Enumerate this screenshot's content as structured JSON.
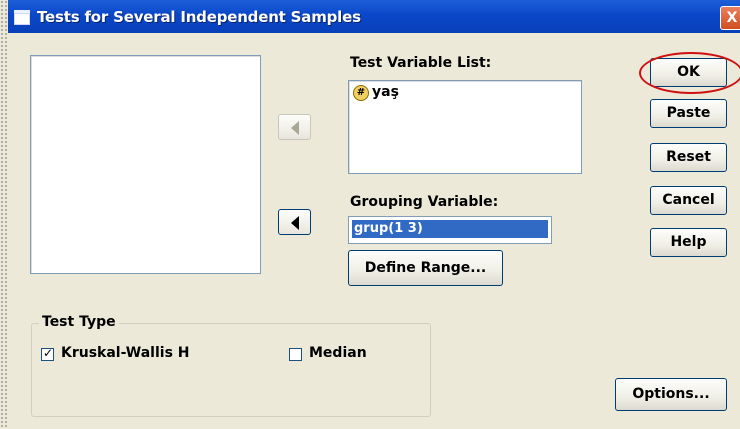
{
  "window": {
    "title": "Tests for Several Independent Samples",
    "close_glyph": "X"
  },
  "test_variable_list": {
    "label": "Test Variable List:",
    "items": [
      {
        "icon": "scale-variable-icon",
        "icon_glyph": "#",
        "name": "yaş"
      }
    ]
  },
  "grouping_variable": {
    "label": "Grouping Variable:",
    "value": "grup(1 3)"
  },
  "buttons": {
    "define_range": "Define Range...",
    "ok": "OK",
    "paste": "Paste",
    "reset": "Reset",
    "cancel": "Cancel",
    "help": "Help",
    "options": "Options..."
  },
  "test_type": {
    "legend": "Test Type",
    "kruskal": {
      "label": "Kruskal-Wallis H",
      "checked": true,
      "mark": "✓"
    },
    "median": {
      "label": "Median",
      "checked": false
    }
  },
  "annotation": {
    "ok_circle_color": "#d01010"
  }
}
